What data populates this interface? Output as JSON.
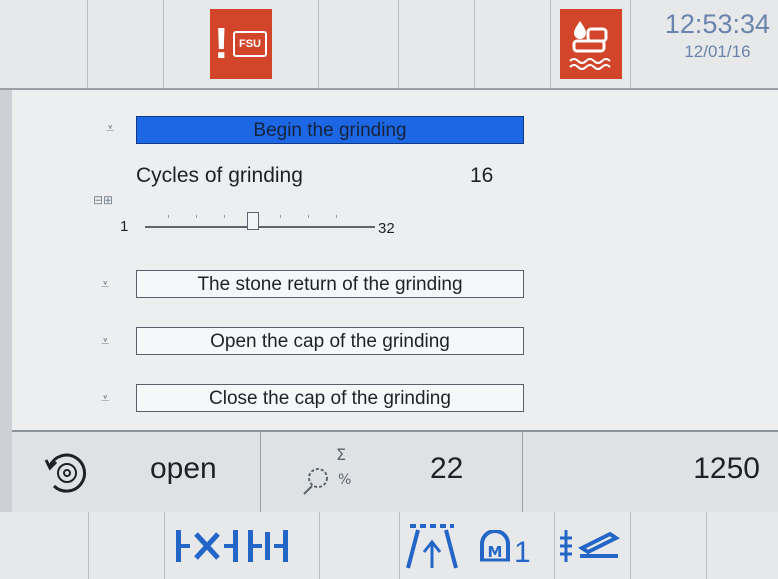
{
  "status": {
    "time": "12:53:34",
    "date": "12/01/16",
    "fsu_label": "FSU"
  },
  "panel": {
    "begin_label": "Begin the grinding",
    "cycles_label": "Cycles of grinding",
    "cycles_value": "16",
    "slider_min": "1",
    "slider_max": "32",
    "stone_return_label": "The stone return of the grinding",
    "open_cap_label": "Open the cap of the grinding",
    "close_cap_label": "Close the cap of the grinding"
  },
  "statusbar": {
    "state": "open",
    "count": "22",
    "value": "1250"
  },
  "bottom": {
    "m_index": "1"
  },
  "colors": {
    "alert": "#d2452a",
    "selected": "#1d66e4",
    "icon_blue": "#2466c8"
  }
}
